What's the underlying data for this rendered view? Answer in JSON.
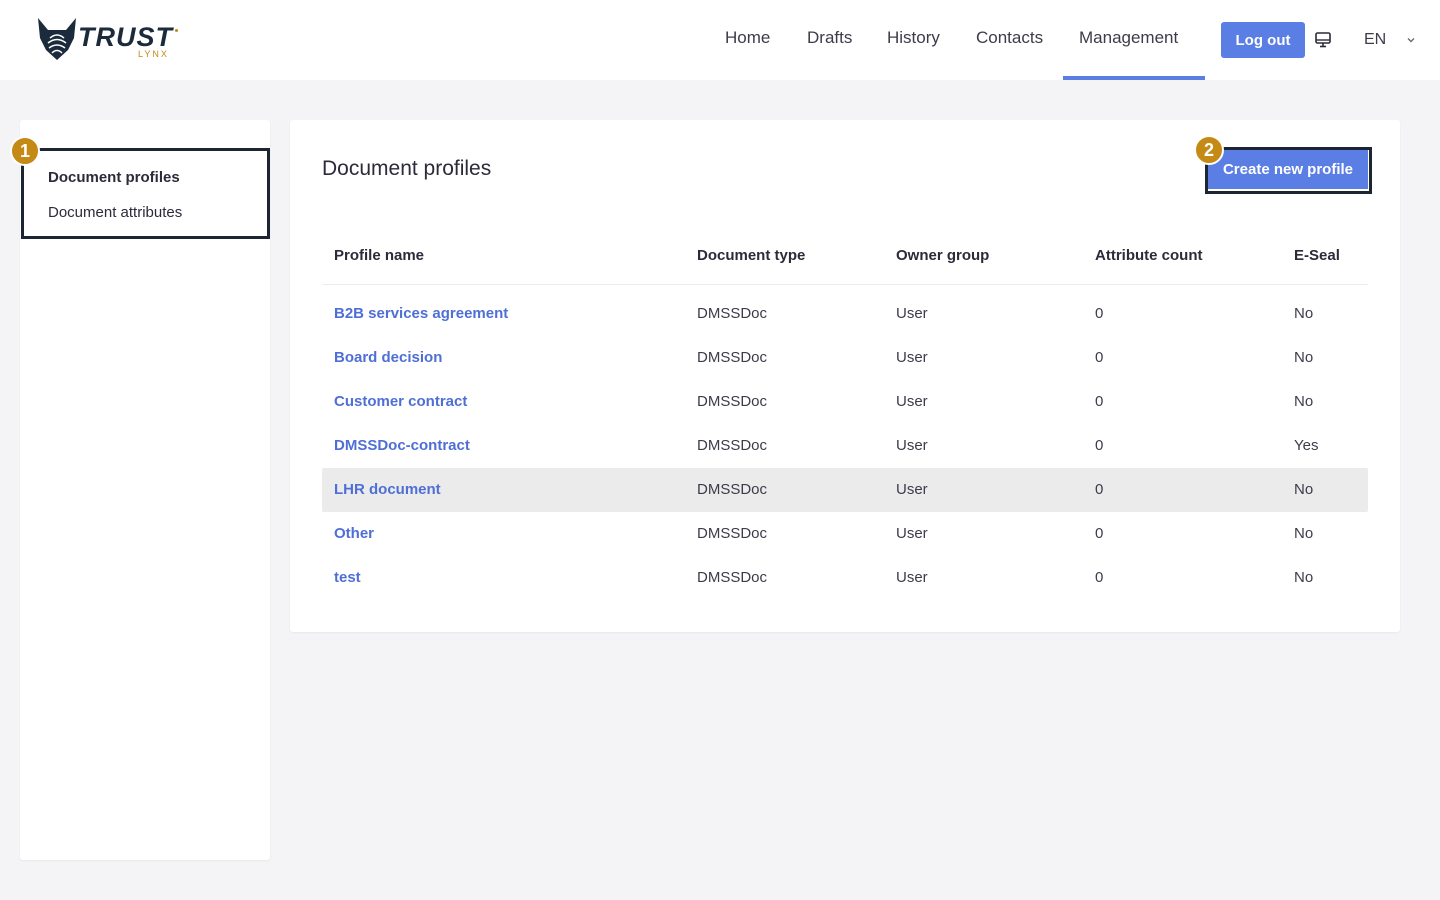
{
  "header": {
    "logo_text": "TRUST",
    "logo_sub": "LYNX",
    "nav": [
      "Home",
      "Drafts",
      "History",
      "Contacts",
      "Management"
    ],
    "active_nav": "Management",
    "logout_label": "Log out",
    "language": "EN"
  },
  "sidebar": {
    "items": [
      {
        "label": "Document profiles",
        "active": true
      },
      {
        "label": "Document attributes",
        "active": false
      }
    ],
    "badge": "1"
  },
  "main": {
    "title": "Document profiles",
    "create_label": "Create new profile",
    "create_badge": "2",
    "columns": [
      "Profile name",
      "Document type",
      "Owner group",
      "Attribute count",
      "E-Seal"
    ],
    "rows": [
      [
        "B2B services agreement",
        "DMSSDoc",
        "User",
        "0",
        "No"
      ],
      [
        "Board decision",
        "DMSSDoc",
        "User",
        "0",
        "No"
      ],
      [
        "Customer contract",
        "DMSSDoc",
        "User",
        "0",
        "No"
      ],
      [
        "DMSSDoc-contract",
        "DMSSDoc",
        "User",
        "0",
        "Yes"
      ],
      [
        "LHR document",
        "DMSSDoc",
        "User",
        "0",
        "No"
      ],
      [
        "Other",
        "DMSSDoc",
        "User",
        "0",
        "No"
      ],
      [
        "test",
        "DMSSDoc",
        "User",
        "0",
        "No"
      ]
    ],
    "highlighted_row": 4
  },
  "colors": {
    "accent": "#5b7ee4",
    "link": "#4f6fd6",
    "badge": "#c58a16",
    "outline": "#1d2433"
  }
}
